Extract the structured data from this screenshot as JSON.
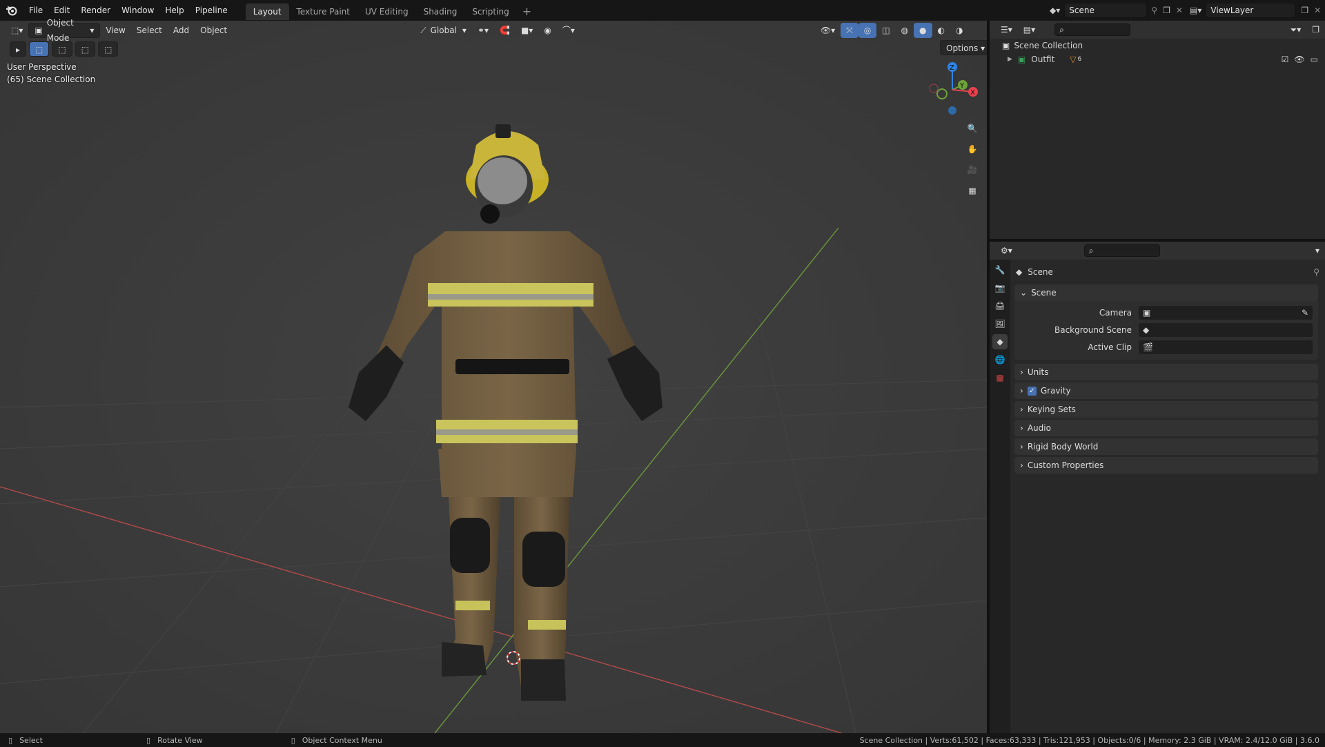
{
  "menus": [
    "File",
    "Edit",
    "Render",
    "Window",
    "Help",
    "Pipeline"
  ],
  "workspaces": [
    "Layout",
    "Texture Paint",
    "UV Editing",
    "Shading",
    "Scripting"
  ],
  "active_workspace": "Layout",
  "scene_name": "Scene",
  "view_layer": "ViewLayer",
  "viewport": {
    "mode": "Object Mode",
    "menus": [
      "View",
      "Select",
      "Add",
      "Object"
    ],
    "orientation": "Global",
    "options_label": "Options",
    "perspective": "User Perspective",
    "collection_info": "(65) Scene Collection",
    "gizmo": {
      "z": "Z",
      "y": "Y",
      "x": "X"
    }
  },
  "outliner": {
    "root": "Scene Collection",
    "items": [
      {
        "label": "Outfit",
        "badge": "6"
      }
    ]
  },
  "properties": {
    "header": "Scene",
    "section": "Scene",
    "fields": [
      {
        "label": "Camera"
      },
      {
        "label": "Background Scene"
      },
      {
        "label": "Active Clip"
      }
    ],
    "panels": [
      "Units",
      "Gravity",
      "Keying Sets",
      "Audio",
      "Rigid Body World",
      "Custom Properties"
    ]
  },
  "statusbar": {
    "select": "Select",
    "rotate": "Rotate View",
    "context": "Object Context Menu",
    "stats": "Scene Collection | Verts:61,502 | Faces:63,333 | Tris:121,953 | Objects:0/6 | Memory: 2.3 GiB | VRAM: 2.4/12.0 GiB | 3.6.0"
  },
  "colors": {
    "accent": "#4772b3",
    "x_axis": "#e8424f",
    "y_axis": "#6ea33a",
    "z_axis": "#2f84e3"
  }
}
